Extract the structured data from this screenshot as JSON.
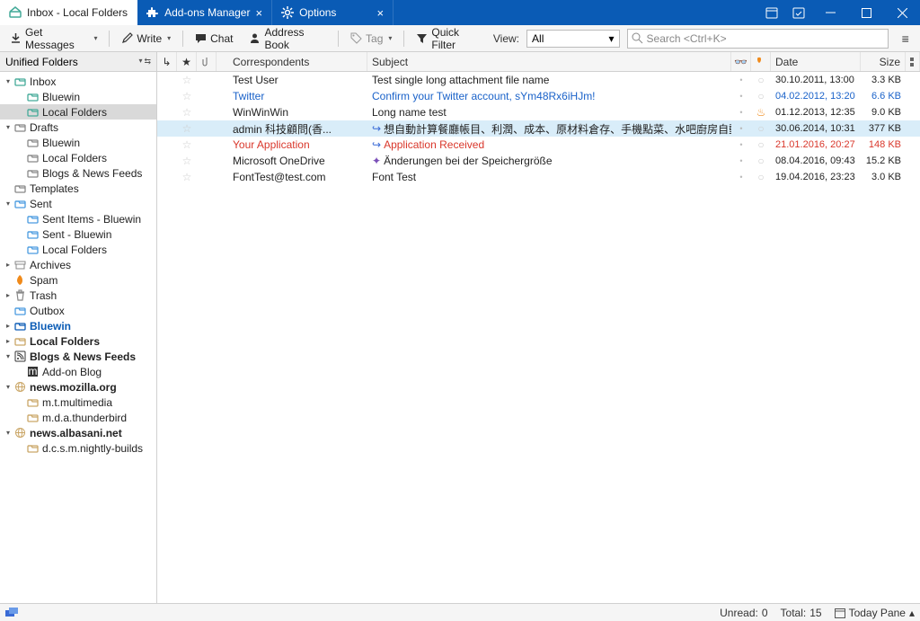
{
  "tabs": [
    {
      "label": "Inbox - Local Folders"
    },
    {
      "label": "Add-ons Manager"
    },
    {
      "label": "Options"
    }
  ],
  "toolbar": {
    "get": "Get Messages",
    "write": "Write",
    "chat": "Chat",
    "address": "Address Book",
    "tag": "Tag",
    "quick": "Quick Filter",
    "view": "View:",
    "view_value": "All",
    "search_placeholder": "Search <Ctrl+K>"
  },
  "sidebar": {
    "header": "Unified Folders",
    "items": [
      {
        "d": 0,
        "tw": "v",
        "ic": "inbox",
        "label": "Inbox",
        "cls": ""
      },
      {
        "d": 1,
        "tw": "",
        "ic": "inbox",
        "label": "Bluewin",
        "cls": ""
      },
      {
        "d": 1,
        "tw": "",
        "ic": "inbox",
        "label": "Local Folders",
        "cls": "",
        "sel": true
      },
      {
        "d": 0,
        "tw": "v",
        "ic": "draft",
        "label": "Drafts",
        "cls": ""
      },
      {
        "d": 1,
        "tw": "",
        "ic": "draft",
        "label": "Bluewin",
        "cls": ""
      },
      {
        "d": 1,
        "tw": "",
        "ic": "draft",
        "label": "Local Folders",
        "cls": ""
      },
      {
        "d": 1,
        "tw": "",
        "ic": "draft",
        "label": "Blogs & News Feeds",
        "cls": ""
      },
      {
        "d": 0,
        "tw": "",
        "ic": "draft",
        "label": "Templates",
        "cls": ""
      },
      {
        "d": 0,
        "tw": "v",
        "ic": "sent",
        "label": "Sent",
        "cls": ""
      },
      {
        "d": 1,
        "tw": "",
        "ic": "sent",
        "label": "Sent Items - Bluewin",
        "cls": ""
      },
      {
        "d": 1,
        "tw": "",
        "ic": "sent",
        "label": "Sent - Bluewin",
        "cls": ""
      },
      {
        "d": 1,
        "tw": "",
        "ic": "sent",
        "label": "Local Folders",
        "cls": ""
      },
      {
        "d": 0,
        "tw": ">",
        "ic": "archive",
        "label": "Archives",
        "cls": ""
      },
      {
        "d": 0,
        "tw": "",
        "ic": "spam",
        "label": "Spam",
        "cls": ""
      },
      {
        "d": 0,
        "tw": ">",
        "ic": "trash",
        "label": "Trash",
        "cls": ""
      },
      {
        "d": 0,
        "tw": "",
        "ic": "outbox",
        "label": "Outbox",
        "cls": ""
      },
      {
        "d": 0,
        "tw": ">",
        "ic": "acct",
        "label": "Bluewin",
        "cls": "blue"
      },
      {
        "d": 0,
        "tw": ">",
        "ic": "folder",
        "label": "Local Folders",
        "cls": "bold"
      },
      {
        "d": 0,
        "tw": "v",
        "ic": "rss",
        "label": "Blogs & News Feeds",
        "cls": "bold"
      },
      {
        "d": 1,
        "tw": "",
        "ic": "addon",
        "label": "Add-on Blog",
        "cls": ""
      },
      {
        "d": 0,
        "tw": "v",
        "ic": "globe",
        "label": "news.mozilla.org",
        "cls": "bold"
      },
      {
        "d": 1,
        "tw": "",
        "ic": "news",
        "label": "m.t.multimedia",
        "cls": ""
      },
      {
        "d": 1,
        "tw": "",
        "ic": "news",
        "label": "m.d.a.thunderbird",
        "cls": ""
      },
      {
        "d": 0,
        "tw": "v",
        "ic": "globe",
        "label": "news.albasani.net",
        "cls": "bold"
      },
      {
        "d": 1,
        "tw": "",
        "ic": "news",
        "label": "d.c.s.m.nightly-builds",
        "cls": ""
      }
    ]
  },
  "columns": {
    "corr": "Correspondents",
    "subj": "Subject",
    "date": "Date",
    "size": "Size"
  },
  "messages": [
    {
      "corr": "Test User",
      "subj": "Test single long attachment file name",
      "date": "30.10.2011, 13:00",
      "size": "3.3 KB",
      "cls": "",
      "pre": ""
    },
    {
      "corr": "Twitter",
      "subj": "Confirm your Twitter account, sYm48Rx6iHJm!",
      "date": "04.02.2012, 13:20",
      "size": "6.6 KB",
      "cls": "blue",
      "pre": ""
    },
    {
      "corr": "WinWinWin",
      "subj": "Long name test",
      "date": "01.12.2013, 12:35",
      "size": "9.0 KB",
      "cls": "",
      "pre": "",
      "flame": true
    },
    {
      "corr": "admin 科技顧問(香...",
      "subj": "想自動計算餐廳帳目、利潤、成本、原材料倉存、手機點菜、水吧廚房自動出單 (詳細資料...)",
      "date": "30.06.2014, 10:31",
      "size": "377 KB",
      "cls": "",
      "pre": "fwd",
      "sel": true
    },
    {
      "corr": "Your Application",
      "subj": "Application Received",
      "date": "21.01.2016, 20:27",
      "size": "148 KB",
      "cls": "red",
      "pre": "fwd"
    },
    {
      "corr": "Microsoft OneDrive",
      "subj": "Änderungen bei der Speichergröße",
      "date": "08.04.2016, 09:43",
      "size": "15.2 KB",
      "cls": "",
      "pre": "star"
    },
    {
      "corr": "FontTest@test.com",
      "subj": "Font Test",
      "date": "19.04.2016, 23:23",
      "size": "3.0 KB",
      "cls": "",
      "pre": ""
    }
  ],
  "status": {
    "unread_label": "Unread:",
    "unread_val": "0",
    "total_label": "Total:",
    "total_val": "15",
    "today": "Today Pane"
  }
}
